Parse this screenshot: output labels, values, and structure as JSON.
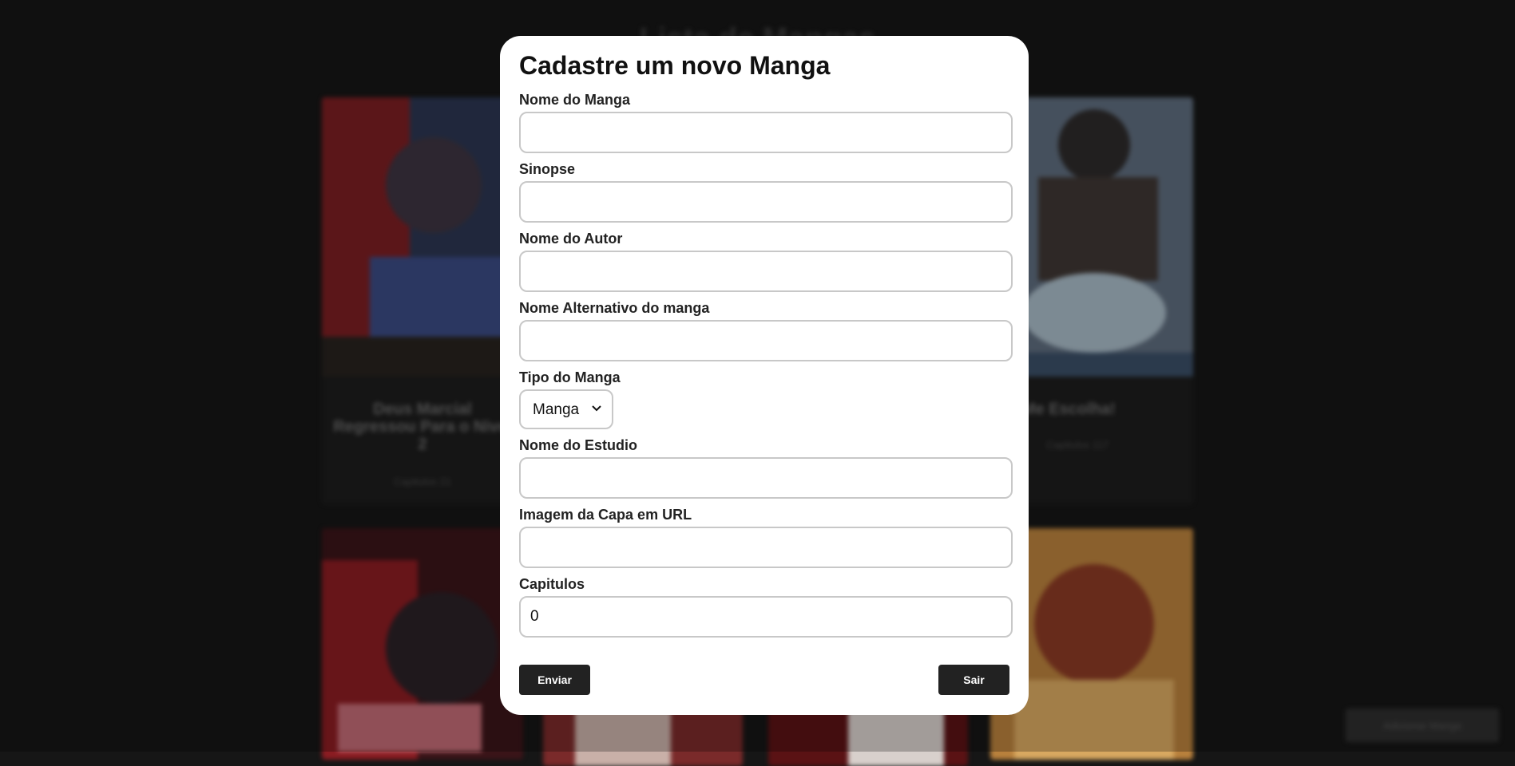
{
  "background": {
    "page_title": "Lista de Mangas",
    "cards": [
      {
        "title": "Deus Marcial Regressou Para o Nivel 2",
        "caps": "Capitulos 21"
      },
      {
        "title": "Me Escolha!",
        "caps": "Capitulos 117"
      }
    ],
    "corner_button": "Adicionar Manga"
  },
  "modal": {
    "title": "Cadastre um novo Manga",
    "fields": {
      "nome": {
        "label": "Nome do Manga",
        "value": ""
      },
      "sinopse": {
        "label": "Sinopse",
        "value": ""
      },
      "autor": {
        "label": "Nome do Autor",
        "value": ""
      },
      "alternativo": {
        "label": "Nome Alternativo do manga",
        "value": ""
      },
      "tipo": {
        "label": "Tipo do Manga",
        "selected": "Manga"
      },
      "estudio": {
        "label": "Nome do Estudio",
        "value": ""
      },
      "capa": {
        "label": "Imagem da Capa em URL",
        "value": ""
      },
      "capitulos": {
        "label": "Capitulos",
        "value": "0"
      }
    },
    "send_label": "Enviar",
    "exit_label": "Sair"
  },
  "colors": {
    "page_bg": "#161616",
    "modal_bg": "#ffffff",
    "button_bg": "#222222",
    "input_border": "#c8c8c8"
  }
}
